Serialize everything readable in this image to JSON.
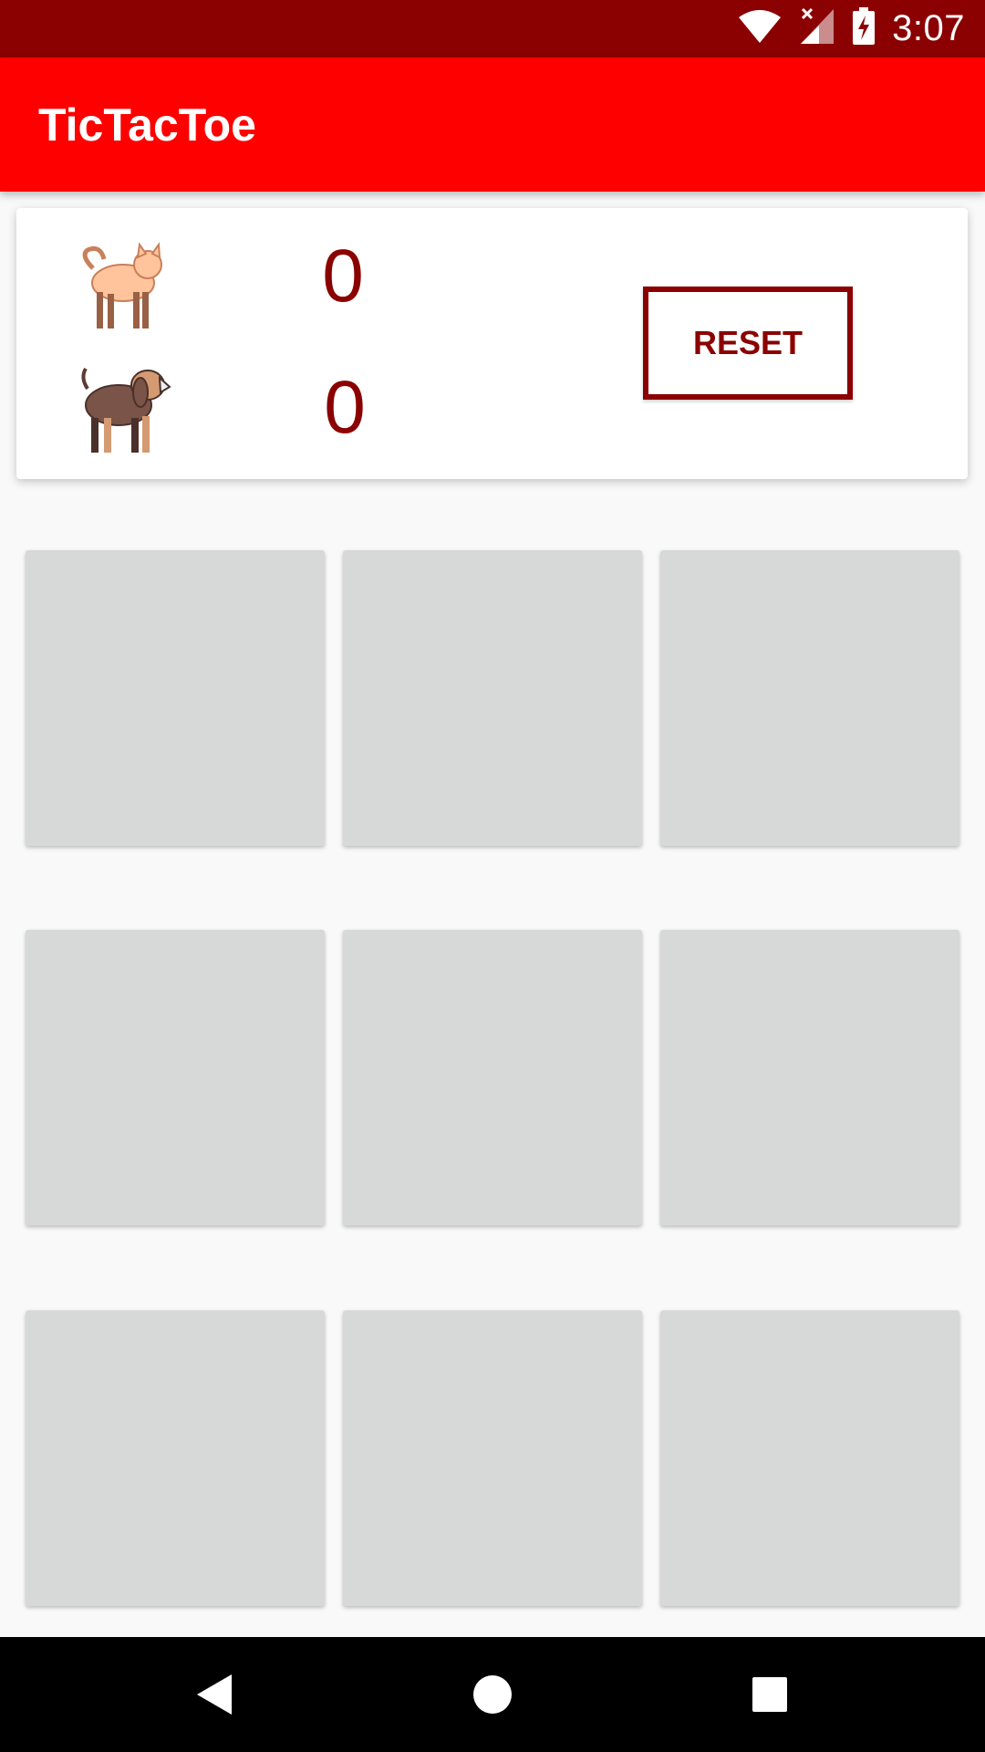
{
  "status_bar": {
    "time": "3:07",
    "icons": [
      "wifi-icon",
      "cell-signal-icon",
      "battery-charging-icon"
    ],
    "background": "#8b0000"
  },
  "app_bar": {
    "title": "TicTacToe",
    "background": "#ff0000"
  },
  "scoreboard": {
    "players": [
      {
        "icon": "cat-icon",
        "score": "0"
      },
      {
        "icon": "dog-icon",
        "score": "0"
      }
    ],
    "reset_label": "RESET",
    "accent": "#8b0000"
  },
  "board": {
    "cells": [
      "",
      "",
      "",
      "",
      "",
      "",
      "",
      "",
      ""
    ],
    "cell_color": "#d7d8d8"
  },
  "nav_bar": {
    "buttons": [
      "back-icon",
      "home-icon",
      "recents-icon"
    ]
  }
}
